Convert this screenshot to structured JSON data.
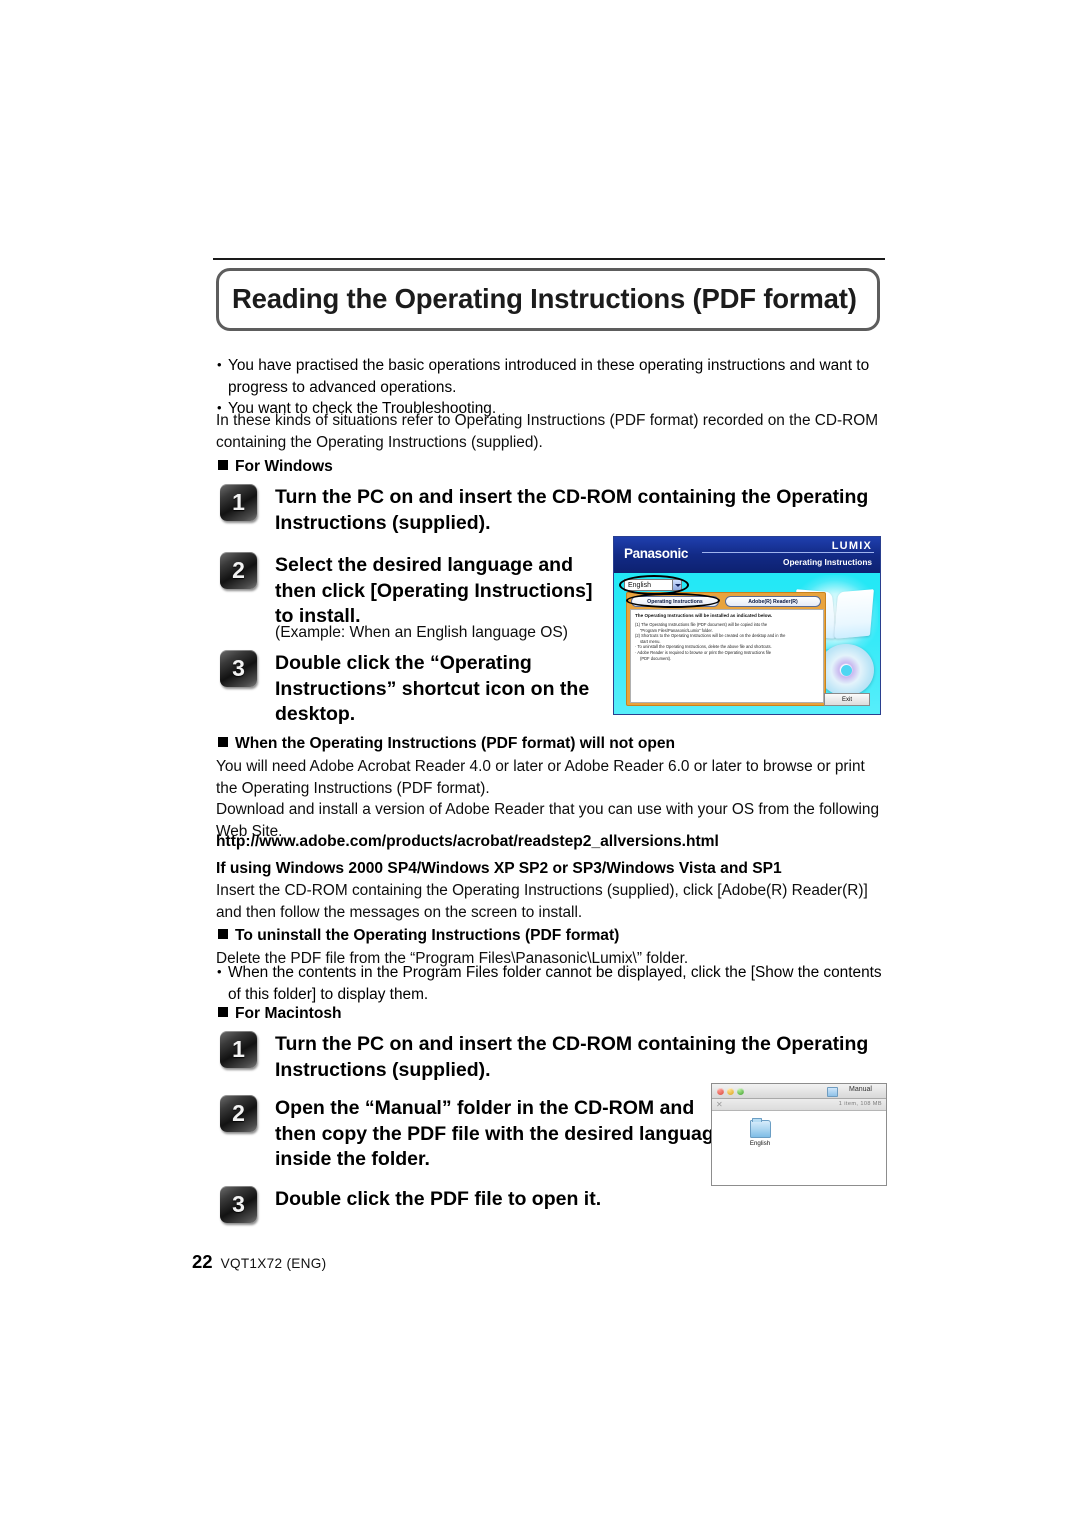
{
  "page": {
    "title": "Reading the Operating Instructions (PDF format)",
    "footer_page_number": "22",
    "footer_code": "VQT1X72 (ENG)"
  },
  "intro": {
    "bullets": [
      "You have practised the basic operations introduced in these operating instructions and want to progress to advanced operations.",
      "You want to check the Troubleshooting."
    ],
    "paragraph": "In these kinds of situations refer to Operating Instructions (PDF format) recorded on the CD-ROM containing the Operating Instructions (supplied)."
  },
  "windows_section": {
    "heading": "For Windows",
    "steps": [
      {
        "number": "1",
        "text": "Turn the PC on and insert the CD-ROM containing the Operating Instructions (supplied)."
      },
      {
        "number": "2",
        "text": "Select the desired language and then click [Operating Instructions] to install.",
        "note": "(Example: When an English language OS)"
      },
      {
        "number": "3",
        "text": "Double click the “Operating Instructions” shortcut icon on the desktop."
      }
    ]
  },
  "installer_screenshot": {
    "brand": "Panasonic",
    "lumix": "LUMIX",
    "subtitle": "Operating Instructions",
    "language_value": "English",
    "tabs": [
      "Operating Instructions",
      "Adobe(R) Reader(R)"
    ],
    "body_heading": "The Operating Instructions will be installed as indicated below.",
    "body_lines": [
      "(1) The Operating Instructions file (PDF document) will be copied into the",
      "“Program Files\\Panasonic\\Lumix” folder.",
      "(2) Shortcuts to the Operating Instructions will be created on the desktop and in the",
      "start menu.",
      "· To uninstall the Operating Instructions, delete the above file and shortcuts.",
      "· Adobe Reader is required to browse or print the Operating Instructions file",
      "(PDF document)."
    ],
    "exit_label": "Exit"
  },
  "not_open_section": {
    "heading": "When the Operating Instructions (PDF format) will not open",
    "paragraph1": "You will need Adobe Acrobat Reader 4.0 or later or Adobe Reader 6.0 or later to browse or print the Operating Instructions (PDF format).",
    "paragraph2": "Download and install a version of Adobe Reader that you can use with your OS from the following Web Site.",
    "url": "http://www.adobe.com/products/acrobat/readstep2_allversions.html"
  },
  "windows_versions_section": {
    "heading": "If using Windows 2000 SP4/Windows XP SP2 or SP3/Windows Vista and SP1",
    "paragraph": "Insert the CD-ROM containing the Operating Instructions (supplied), click [Adobe(R) Reader(R)] and then follow the messages on the screen to install."
  },
  "uninstall_section": {
    "heading": "To uninstall the Operating Instructions (PDF format)",
    "paragraph": "Delete the PDF file from the “Program Files\\Panasonic\\Lumix\\” folder.",
    "bullet": "When the contents in the Program Files folder cannot be displayed, click the [Show the contents of this folder] to display them."
  },
  "macintosh_section": {
    "heading": "For Macintosh",
    "steps": [
      {
        "number": "1",
        "text": "Turn the PC on and insert the CD-ROM containing the Operating Instructions (supplied)."
      },
      {
        "number": "2",
        "text": "Open the “Manual” folder in the CD-ROM and then copy the PDF file with the desired language inside the folder."
      },
      {
        "number": "3",
        "text": "Double click the PDF file to open it."
      }
    ]
  },
  "finder_screenshot": {
    "window_title": "Manual",
    "toolbar_meta": "1 item, 108 MB",
    "item_label": "English"
  },
  "colors": {
    "installer_header": "#13278a",
    "installer_background": "#2ce9f7",
    "installer_panel": "#e8a33d",
    "title_border": "#5d5d5d"
  }
}
